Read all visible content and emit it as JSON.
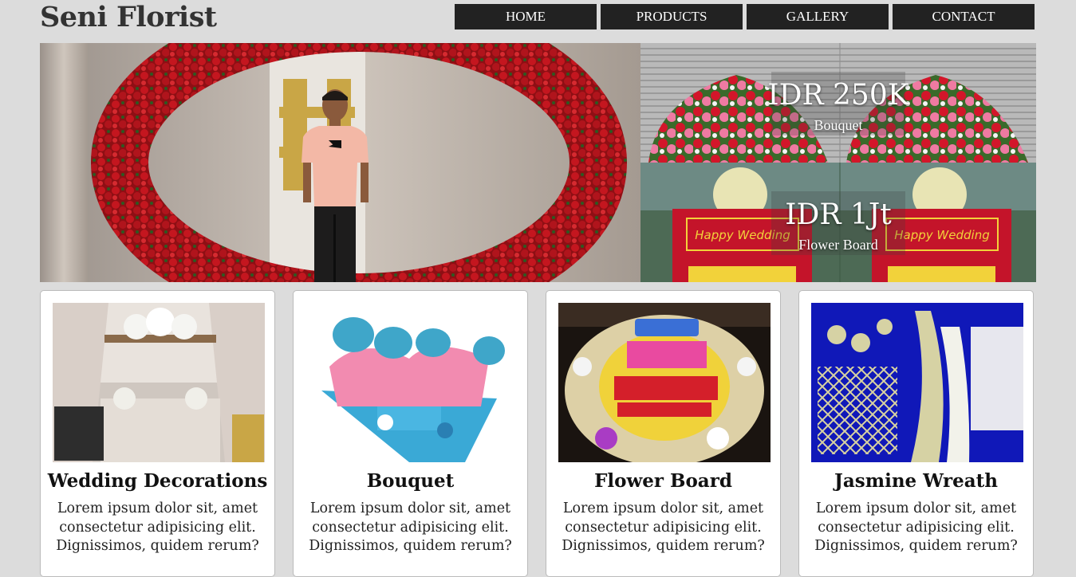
{
  "brand": {
    "name": "Seni Florist"
  },
  "nav": {
    "items": [
      {
        "label": "HOME"
      },
      {
        "label": "PRODUCTS"
      },
      {
        "label": "GALLERY"
      },
      {
        "label": "CONTACT"
      }
    ]
  },
  "promos": [
    {
      "price": "IDR 250K",
      "caption": "Bouquet"
    },
    {
      "price": "IDR 1Jt",
      "caption": "Flower Board"
    }
  ],
  "flower_board_banner": {
    "headline": "Happy Wedding"
  },
  "cards": [
    {
      "title": "Wedding Decorations",
      "text": "Lorem ipsum dolor sit, amet consectetur adipisicing elit. Dignissimos, quidem rerum?"
    },
    {
      "title": "Bouquet",
      "text": "Lorem ipsum dolor sit, amet consectetur adipisicing elit. Dignissimos, quidem rerum?"
    },
    {
      "title": "Flower Board",
      "text": "Lorem ipsum dolor sit, amet consectetur adipisicing elit. Dignissimos, quidem rerum?"
    },
    {
      "title": "Jasmine Wreath",
      "text": "Lorem ipsum dolor sit, amet consectetur adipisicing elit. Dignissimos, quidem rerum?"
    }
  ],
  "colors": {
    "page_bg": "#dcdcdc",
    "nav_bg": "#222222",
    "nav_text": "#ffffff",
    "card_bg": "#ffffff",
    "rose_red": "#b3121b"
  }
}
